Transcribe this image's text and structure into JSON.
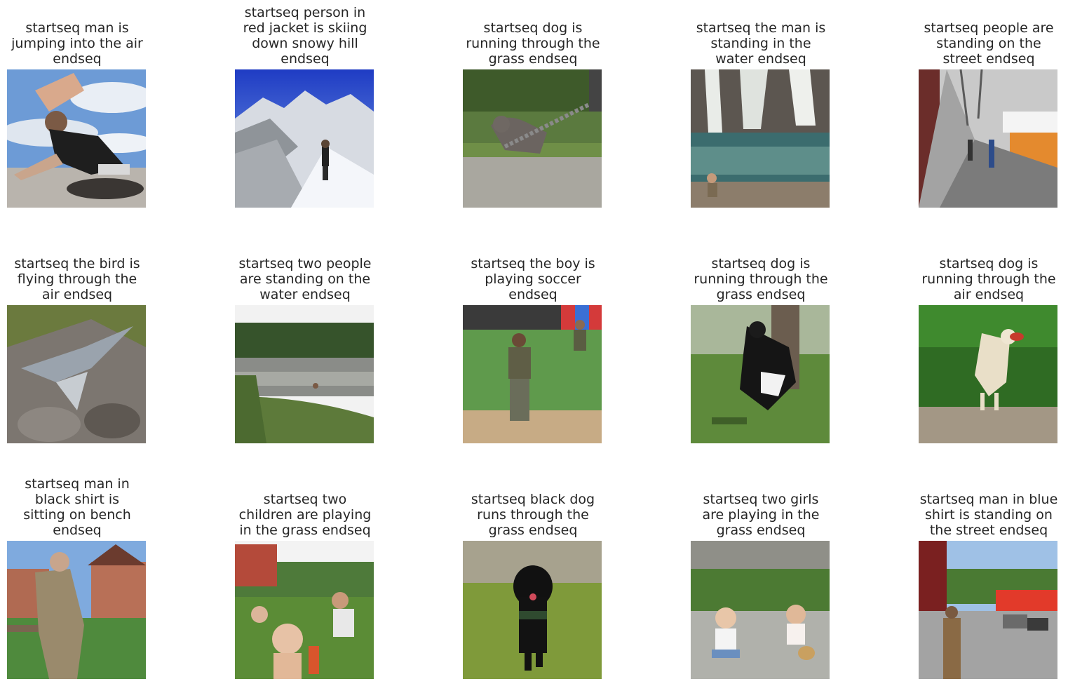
{
  "figure": {
    "panels": [
      {
        "caption": "startseq man is\njumping into the air\nendseq",
        "scene": "man-jumping-sky"
      },
      {
        "caption": "startseq person in\nred jacket is skiing\ndown snowy hill\nendseq",
        "scene": "skier-snowy-mountain"
      },
      {
        "caption": "startseq dog is\nrunning through the\ngrass endseq",
        "scene": "dog-on-chain"
      },
      {
        "caption": "startseq the man is\nstanding in the\nwater endseq",
        "scene": "waterfall-man"
      },
      {
        "caption": "startseq people are\nstanding on the\nstreet endseq",
        "scene": "street-market"
      },
      {
        "caption": "startseq the bird is\nflying through the\nair endseq",
        "scene": "heron-on-rocks"
      },
      {
        "caption": "startseq two people\nare standing on the\nwater endseq",
        "scene": "pond-forest"
      },
      {
        "caption": "startseq the boy is\nplaying soccer\nendseq",
        "scene": "baseball-field"
      },
      {
        "caption": "startseq dog is\nrunning through the\ngrass endseq",
        "scene": "dog-jumping-yard"
      },
      {
        "caption": "startseq dog is\nrunning through the\nair endseq",
        "scene": "dog-catching-frisbee"
      },
      {
        "caption": "startseq man in\nblack shirt is\nsitting on bench\nendseq",
        "scene": "man-bench-houses"
      },
      {
        "caption": "startseq two\nchildren are playing\nin the grass endseq",
        "scene": "picnic-child"
      },
      {
        "caption": "startseq black dog\nruns through the\ngrass endseq",
        "scene": "black-dog-running"
      },
      {
        "caption": "startseq two girls\nare playing in the\ngrass endseq",
        "scene": "girls-sidewalk-chalk"
      },
      {
        "caption": "startseq man in blue\nshirt is standing on\nthe street endseq",
        "scene": "street-intersection"
      }
    ]
  }
}
